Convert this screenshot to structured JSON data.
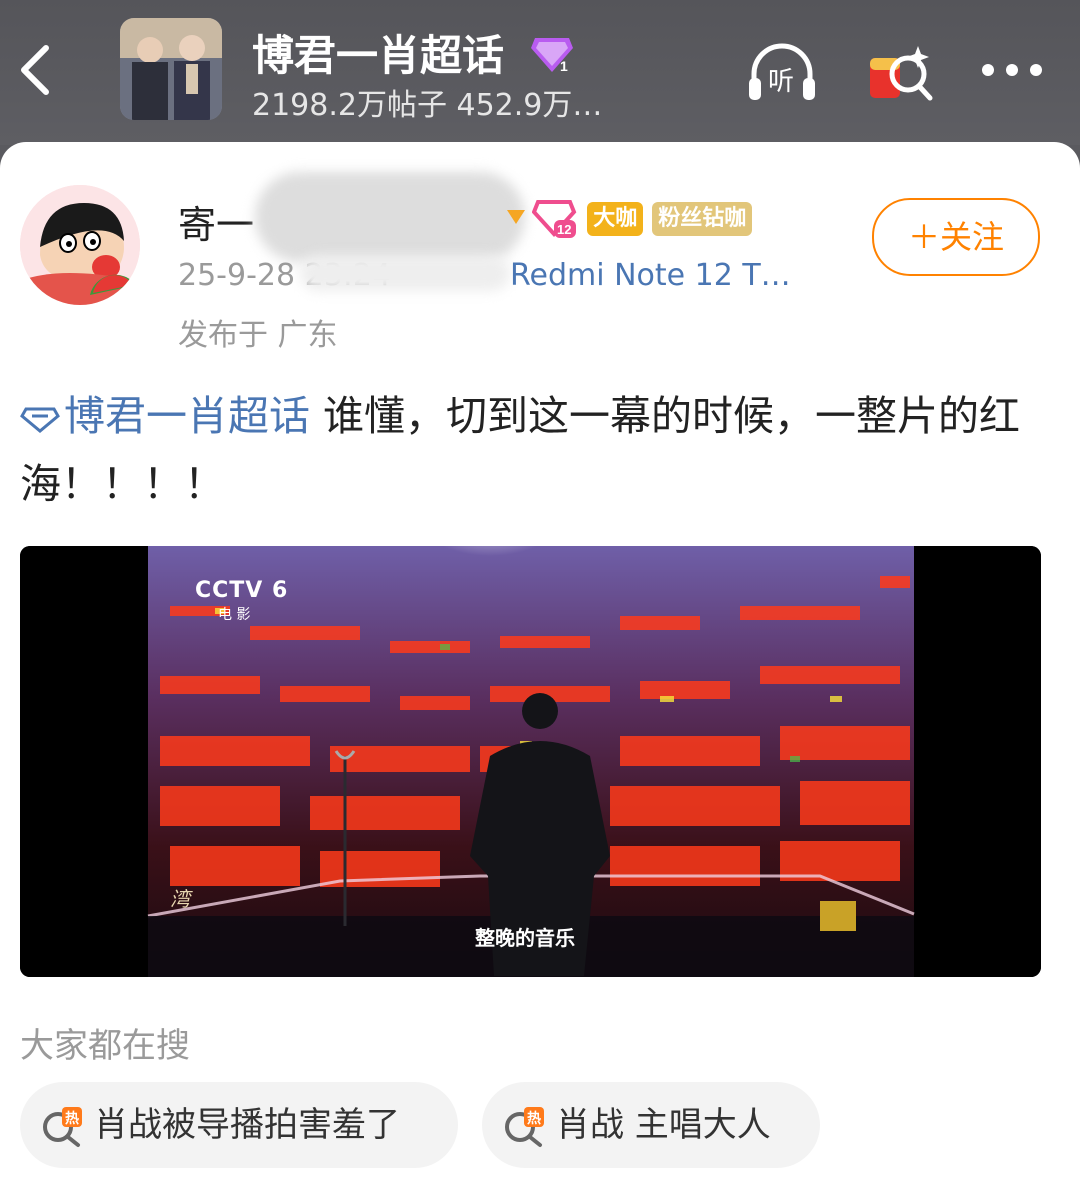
{
  "header": {
    "topic_title": "博君一肖超话",
    "gem_level": "1",
    "stats": "2198.2万帖子 452.9万…",
    "listen_label": "听"
  },
  "post": {
    "username": "寄一",
    "level_badge": "12",
    "badge_daka": "大咖",
    "badge_fan": "粉丝钻咖",
    "time": "25-9-28 23:24",
    "device": "Redmi Note 12 T…",
    "location": "发布于 广东",
    "follow_label": "＋关注",
    "topic_tag": "博君一肖超话",
    "text": " 谁懂，切到这一幕的时候，一整片的红海！！！！"
  },
  "video": {
    "channel": "CCTV 6",
    "channel_sub": "电 影",
    "subtitle": "整晚的音乐"
  },
  "search": {
    "title": "大家都在搜",
    "chips": [
      {
        "icon": "hot-search-icon",
        "label": "肖战被导播拍害羞了"
      },
      {
        "icon": "hot-search-icon",
        "label": "肖战 主唱大人"
      }
    ]
  },
  "colors": {
    "accent_orange": "#ff8200",
    "link_blue": "#4a76b3",
    "gem_purple": "#b95cf0"
  }
}
